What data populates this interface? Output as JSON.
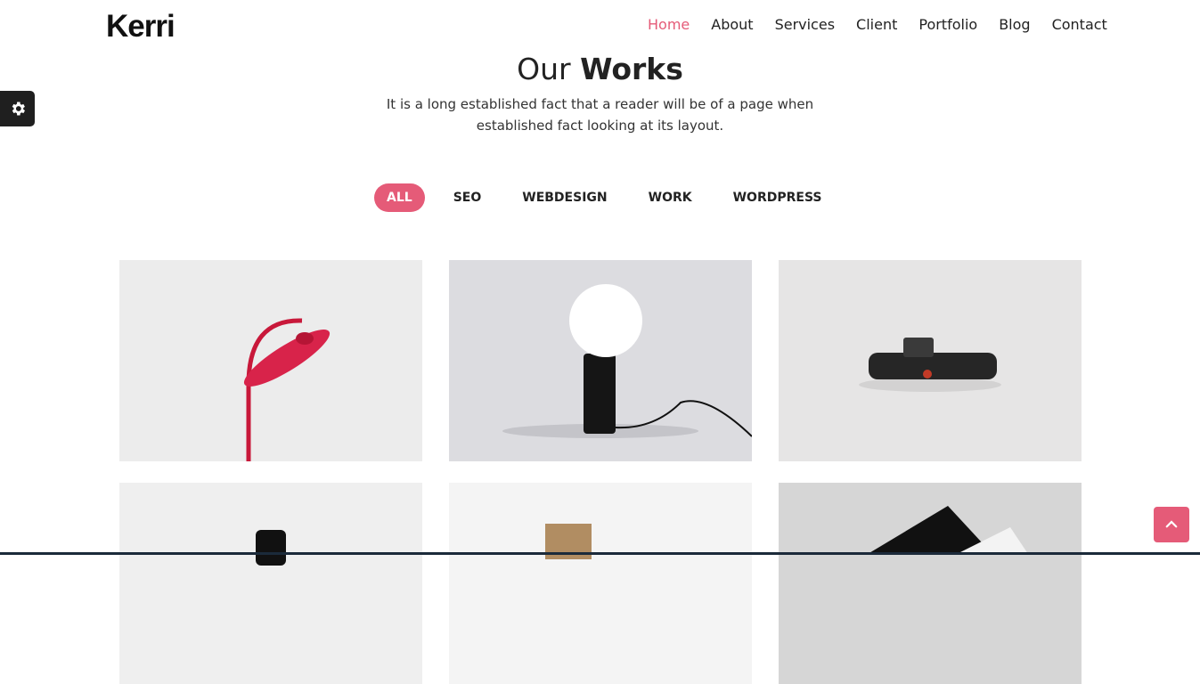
{
  "brand": {
    "logo": "Kerri"
  },
  "nav": {
    "items": [
      "Home",
      "About",
      "Services",
      "Client",
      "Portfolio",
      "Blog",
      "Contact"
    ],
    "active": "Home"
  },
  "section": {
    "title_light": "Our ",
    "title_bold": "Works",
    "subtitle_line1": "It is a long established fact that a reader will be of a page when",
    "subtitle_line2": "established fact looking at its layout."
  },
  "filters": {
    "items": [
      "ALL",
      "SEO",
      "WEBDESIGN",
      "WORK",
      "WORDPRESS"
    ],
    "active": "ALL"
  },
  "portfolio": {
    "items": [
      {
        "icon": "red-desk-lamp-image"
      },
      {
        "icon": "globe-lamp-image"
      },
      {
        "icon": "camera-device-image"
      },
      {
        "icon": "black-cylinder-image"
      },
      {
        "icon": "business-card-image"
      },
      {
        "icon": "paper-sheets-image"
      }
    ]
  },
  "widgets": {
    "settings_icon": "gear-icon",
    "scroll_top_icon": "chevron-up-icon"
  },
  "colors": {
    "accent": "#e55b78",
    "dark": "#1f1f1f"
  }
}
